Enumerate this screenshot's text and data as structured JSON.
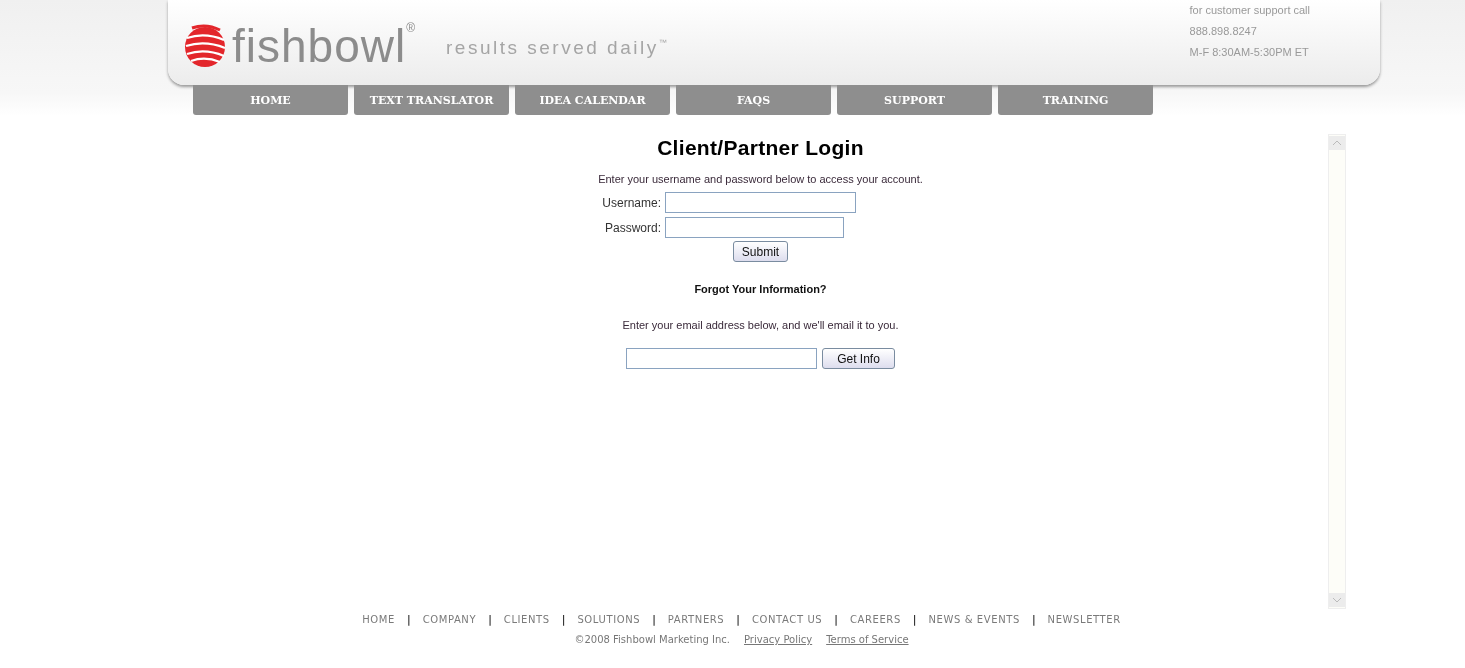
{
  "header": {
    "logo": "fishbowl$^{®}$",
    "tagline": "results served daily$^{™}$",
    "support": [
      "for customer support call",
      "888.898.8247",
      "M-F 8:30AM-5:30PM ET"
    ]
  },
  "nav": [
    {
      "label": "HOME"
    },
    {
      "label": "TEXT TRANSLATOR"
    },
    {
      "label": "IDEA CALENDAR"
    },
    {
      "label": "FAQS"
    },
    {
      "label": "SUPPORT"
    },
    {
      "label": "TRAINING"
    }
  ],
  "login": {
    "title": "Client/Partner Login",
    "intro": "Enter your username and password below to access your account.",
    "username_label": "Username:",
    "password_label": "Password:",
    "submit": "Submit",
    "forgot_title": "Forgot Your Information?",
    "forgot_text": "Enter your email address below, and we'll email it to you.",
    "get_info": "Get Info"
  },
  "footer": {
    "links": [
      {
        "kind": "link",
        "text": "HOME"
      },
      {
        "kind": "separator",
        "text": "|"
      },
      {
        "kind": "link",
        "text": "COMPANY"
      },
      {
        "kind": "separator",
        "text": "|"
      },
      {
        "kind": "link",
        "text": "CLIENTS"
      },
      {
        "kind": "separator",
        "text": "|"
      },
      {
        "kind": "link",
        "text": "SOLUTIONS"
      },
      {
        "kind": "separator",
        "text": "|"
      },
      {
        "kind": "link",
        "text": "PARTNERS"
      },
      {
        "kind": "separator",
        "text": "|"
      },
      {
        "kind": "link",
        "text": "CONTACT US"
      },
      {
        "kind": "separator",
        "text": "|"
      },
      {
        "kind": "link",
        "text": "CAREERS"
      },
      {
        "kind": "separator",
        "text": "|"
      },
      {
        "kind": "link",
        "text": "NEWS & EVENTS"
      },
      {
        "kind": "separator",
        "text": "|"
      },
      {
        "kind": "link",
        "text": "NEWSLETTER"
      }
    ],
    "copyright": "©2008 Fishbowl Marketing Inc.",
    "legal": [
      "Privacy Policy",
      "Terms of Service"
    ]
  }
}
